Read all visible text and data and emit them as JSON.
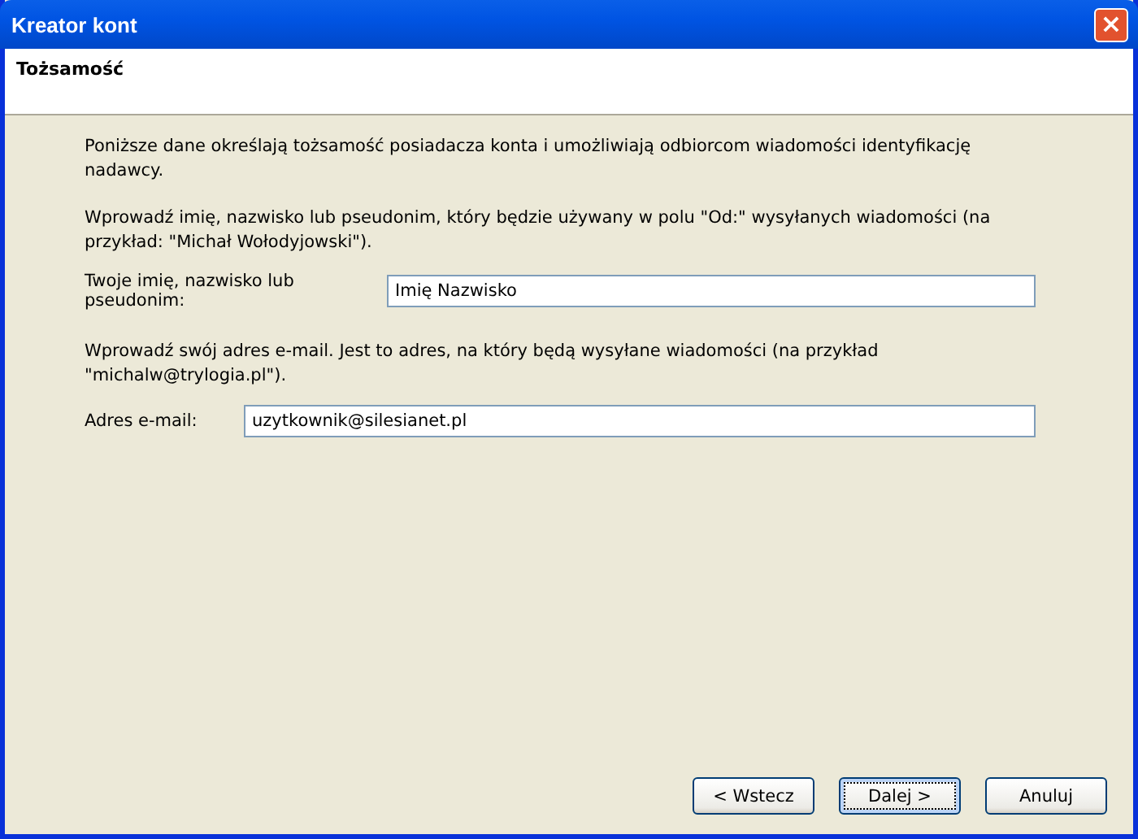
{
  "window": {
    "title": "Kreator kont",
    "close_label": "×"
  },
  "header": {
    "title": "Tożsamość"
  },
  "intro": "Poniższe dane określają tożsamość posiadacza konta i umożliwiają odbiorcom wiadomości identyfikację nadawcy.",
  "sections": [
    {
      "description": "Wprowadź imię, nazwisko lub pseudonim, który będzie używany w polu \"Od:\" wysyłanych wiadomości (na przykład: \"Michał Wołodyjowski\").",
      "label": "Twoje imię, nazwisko lub pseudonim:",
      "value": "Imię Nazwisko"
    },
    {
      "description": "Wprowadź swój adres e-mail. Jest to adres, na który będą wysyłane wiadomości (na przykład \"michalw@trylogia.pl\").",
      "label": "Adres e-mail:",
      "value": "uzytkownik@silesianet.pl"
    }
  ],
  "buttons": [
    {
      "label": "< Wstecz",
      "default": false
    },
    {
      "label": "Dalej >",
      "default": true
    },
    {
      "label": "Anuluj",
      "default": false
    }
  ]
}
